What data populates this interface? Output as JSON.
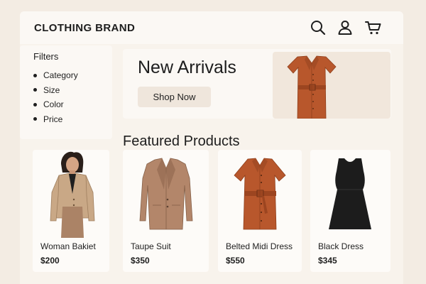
{
  "header": {
    "brand": "CLOTHING BRAND",
    "icons": [
      "search-icon",
      "user-icon",
      "cart-icon"
    ]
  },
  "filters": {
    "title": "Filters",
    "items": [
      {
        "label": "Category"
      },
      {
        "label": "Size"
      },
      {
        "label": "Color"
      },
      {
        "label": "Price"
      }
    ]
  },
  "hero": {
    "title": "New Arrivals",
    "button_label": "Shop Now"
  },
  "featured": {
    "title": "Featured Products",
    "products": [
      {
        "name": "Woman Bakiet",
        "price": "$200"
      },
      {
        "name": "Taupe Suit",
        "price": "$350"
      },
      {
        "name": "Belted Midi Dress",
        "price": "$550"
      },
      {
        "name": "Black Dress",
        "price": "$345"
      }
    ]
  },
  "colors": {
    "page_background": "#f3ece3",
    "panel": "#fbf8f4",
    "rust_dress": "#b8572c",
    "camel_blazer": "#c9a886",
    "taupe_suit": "#b3866a",
    "black_dress": "#1c1c1c"
  }
}
